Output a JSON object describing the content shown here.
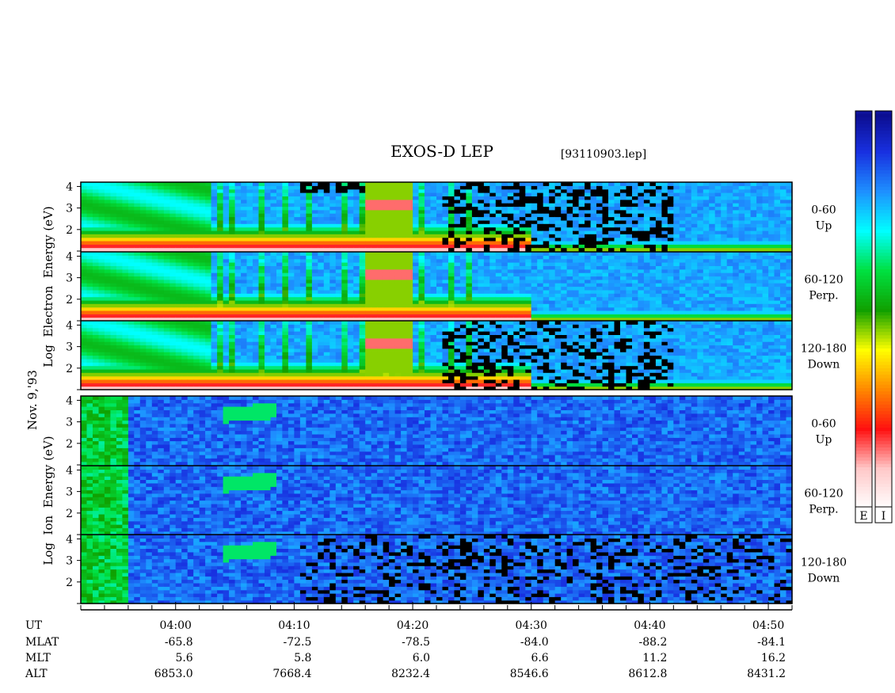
{
  "title": "EXOS-D LEP",
  "filename": "[93110903.lep]",
  "date_label": "Nov. 9,'93",
  "electron_panel_ylabel": "Log  Electron  Energy (eV)",
  "ion_panel_ylabel": "Log  Ion  Energy (eV)",
  "colorbar_labels": [
    "E",
    "I"
  ],
  "chart_data": {
    "type": "heatmap",
    "x_axis": {
      "quantity": "UT",
      "range": [
        "03:52",
        "04:52"
      ],
      "tick_labels": [
        "04:00",
        "04:10",
        "04:20",
        "04:30",
        "04:40",
        "04:50"
      ],
      "tick_times_min": [
        240,
        250,
        260,
        270,
        280,
        290
      ],
      "minor_tick_interval_min": 2
    },
    "y_axis": {
      "label": "Log Energy (eV)",
      "scale": "log10",
      "range": [
        1,
        4.2
      ],
      "tick_labels": [
        "1",
        "2",
        "3",
        "4"
      ]
    },
    "panels": [
      {
        "species": "Electron",
        "pitch_angle": "0-60",
        "direction": "Up"
      },
      {
        "species": "Electron",
        "pitch_angle": "60-120",
        "direction": "Perp."
      },
      {
        "species": "Electron",
        "pitch_angle": "120-180",
        "direction": "Down"
      },
      {
        "species": "Ion",
        "pitch_angle": "0-60",
        "direction": "Up"
      },
      {
        "species": "Ion",
        "pitch_angle": "60-120",
        "direction": "Perp."
      },
      {
        "species": "Ion",
        "pitch_angle": "120-180",
        "direction": "Down"
      }
    ],
    "ephemeris": {
      "rows": [
        {
          "label": "UT",
          "values": [
            "04:00",
            "04:10",
            "04:20",
            "04:30",
            "04:40",
            "04:50"
          ]
        },
        {
          "label": "MLAT",
          "values": [
            "-65.8",
            "-72.5",
            "-78.5",
            "-84.0",
            "-88.2",
            "-84.1"
          ]
        },
        {
          "label": "MLT",
          "values": [
            "5.6",
            "5.8",
            "6.0",
            "6.6",
            "11.2",
            "16.2"
          ]
        },
        {
          "label": "ALT",
          "values": [
            "6853.0",
            "7668.4",
            "8232.4",
            "8546.6",
            "8612.8",
            "8431.2"
          ]
        }
      ]
    },
    "colorbar": {
      "colors": [
        "#0b0b8a",
        "#1830e0",
        "#1e90ff",
        "#00ffff",
        "#00e040",
        "#10a000",
        "#ffff00",
        "#ff8800",
        "#ff1010",
        "#ffc8c8",
        "#ffffff"
      ],
      "bars": [
        "E",
        "I"
      ]
    },
    "electron_features": {
      "low_energy_band_until_min": 270,
      "broadband_bursts_min": [
        243.5,
        244.5,
        247,
        249,
        251,
        254,
        255.5,
        257.5,
        258.5,
        260.5,
        263,
        264.5
      ],
      "intense_burst_window_min": [
        256,
        259.5
      ],
      "intense_burst_peak_logE": 3.1
    },
    "ion_features": {
      "enhanced_band_min": [
        244,
        248
      ],
      "enhanced_band_logE": [
        3.3,
        3.8
      ],
      "dispersion_start_min": 238
    }
  }
}
